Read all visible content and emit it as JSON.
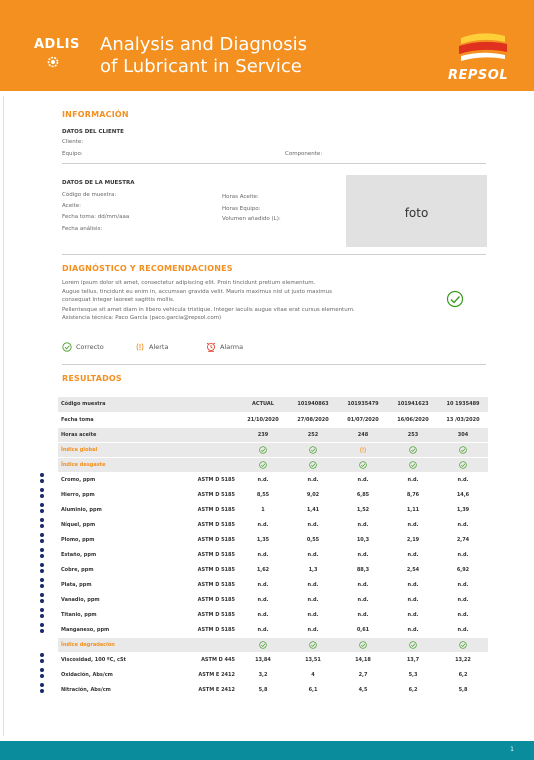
{
  "header": {
    "brand": "ADLIS",
    "title_line1": "Analysis and Diagnosis",
    "title_line2": "of Lubricant in Service",
    "logo_text": "REPSOL"
  },
  "info": {
    "heading": "INFORMACIÓN",
    "client_heading": "DATOS DEL CLIENTE",
    "cliente": "Cliente:",
    "equipo": "Equipo:",
    "componente": "Componente:"
  },
  "sample": {
    "heading": "DATOS DE LA MUESTRA",
    "codigo": "Código de muestra:",
    "aceite": "Aceite:",
    "fecha_toma": "Fecha toma: dd/mm/aaa",
    "fecha_analisis": "Fecha análisis:",
    "horas_aceite": "Horas Aceite:",
    "horas_equipo": "Horas Equipo:",
    "volumen": "Volumen añadido (L):",
    "foto": "foto"
  },
  "diagnosis": {
    "heading": "DIAGNÓSTICO Y RECOMENDACIONES",
    "line1": "Lorem ipsum dolor sit amet, consectetur adipiscing elit. Proin tincidunt pretium elementum.",
    "line2": "Augue tellus, tincidunt eu enim in, accumsan gravida velit. Mauris maximus nisl ut justo maximus",
    "line3": "consequat Integer laoreet sagittis mollis.",
    "line4": "Pellentesque sit amet diam in libero vehicula tristique. Integer iaculis augue vitae erat cursus elementum.",
    "line5": "Asistencia técnica: Paco García (paco.garcia@repsol.com)",
    "legend_ok": "Correcto",
    "legend_alert": "Alerta",
    "legend_alarm": "Alarma"
  },
  "results": {
    "heading": "RESULTADOS",
    "head_rows": [
      {
        "label": "Código muestra",
        "values": [
          "ACTUAL",
          "101940863",
          "101935479",
          "101941623",
          "10 1935489"
        ]
      },
      {
        "label": "Fecha toma",
        "values": [
          "21/10/2020",
          "27/08/2020",
          "01/07/2020",
          "16/06/2020",
          "13 /03/2020"
        ]
      },
      {
        "label": "Horas aceite",
        "values": [
          "239",
          "252",
          "248",
          "253",
          "304"
        ]
      }
    ],
    "index_global": {
      "label": "Índice global",
      "status": [
        "ok",
        "ok",
        "alert",
        "ok",
        "ok"
      ]
    },
    "index_wear": {
      "label": "Índice desgaste",
      "status": [
        "ok",
        "ok",
        "ok",
        "ok",
        "ok"
      ]
    },
    "wear_rows": [
      {
        "name": "Cromo, ppm",
        "std": "ASTM D 5185",
        "values": [
          "n.d.",
          "n.d.",
          "n.d.",
          "n.d.",
          "n.d."
        ],
        "colors": [
          "g",
          "g",
          "g",
          "g",
          "g"
        ]
      },
      {
        "name": "Hierro, ppm",
        "std": "ASTM D 5185",
        "values": [
          "8,55",
          "9,02",
          "6,85",
          "8,76",
          "14,6"
        ],
        "colors": [
          "g",
          "g",
          "g",
          "g",
          "g"
        ]
      },
      {
        "name": "Aluminio, ppm",
        "std": "ASTM D 5185",
        "values": [
          "1",
          "1,41",
          "1,52",
          "1,11",
          "1,39"
        ],
        "colors": [
          "g",
          "g",
          "g",
          "g",
          "g"
        ]
      },
      {
        "name": "Níquel, ppm",
        "std": "ASTM D 5185",
        "values": [
          "n.d.",
          "n.d.",
          "n.d.",
          "n.d.",
          "n.d."
        ],
        "colors": [
          "g",
          "g",
          "g",
          "g",
          "g"
        ]
      },
      {
        "name": "Plomo, ppm",
        "std": "ASTM D 5185",
        "values": [
          "1,35",
          "0,55",
          "10,3",
          "2,19",
          "2,74"
        ],
        "colors": [
          "g",
          "g",
          "o",
          "g",
          "g"
        ]
      },
      {
        "name": "Estaño, ppm",
        "std": "ASTM D 5185",
        "values": [
          "n.d.",
          "n.d.",
          "n.d.",
          "n.d.",
          "n.d."
        ],
        "colors": [
          "g",
          "g",
          "g",
          "g",
          "g"
        ]
      },
      {
        "name": "Cobre, ppm",
        "std": "ASTM D 5185",
        "values": [
          "1,62",
          "1,3",
          "88,3",
          "2,54",
          "6,92"
        ],
        "colors": [
          "g",
          "g",
          "o",
          "g",
          "g"
        ]
      },
      {
        "name": "Plata, ppm",
        "std": "ASTM D 5185",
        "values": [
          "n.d.",
          "n.d.",
          "n.d.",
          "n.d.",
          "n.d."
        ],
        "colors": [
          "g",
          "g",
          "g",
          "g",
          "g"
        ]
      },
      {
        "name": "Vanadio, ppm",
        "std": "ASTM D 5185",
        "values": [
          "n.d.",
          "n.d.",
          "n.d.",
          "n.d.",
          "n.d."
        ],
        "colors": [
          "g",
          "g",
          "g",
          "g",
          "g"
        ]
      },
      {
        "name": "Titanio, ppm",
        "std": "ASTM D 5185",
        "values": [
          "n.d.",
          "n.d.",
          "n.d.",
          "n.d.",
          "n.d."
        ],
        "colors": [
          "g",
          "g",
          "g",
          "g",
          "g"
        ]
      },
      {
        "name": "Manganeso, ppm",
        "std": "ASTM D 5185",
        "values": [
          "n.d.",
          "n.d.",
          "0,61",
          "n.d.",
          "n.d."
        ],
        "colors": [
          "g",
          "g",
          "g",
          "g",
          "g"
        ]
      }
    ],
    "index_degr": {
      "label": "Índice degradación",
      "status": [
        "ok",
        "ok",
        "ok",
        "ok",
        "ok"
      ]
    },
    "degr_rows": [
      {
        "name": "Viscosidad, 100 ºC, cSt",
        "std": "ASTM D 445",
        "values": [
          "13,84",
          "13,51",
          "14,18",
          "13,7",
          "13,22"
        ],
        "colors": [
          "g",
          "g",
          "g",
          "g",
          "g"
        ]
      },
      {
        "name": "Oxidación, Abs/cm",
        "std": "ASTM E 2412",
        "values": [
          "3,2",
          "4",
          "2,7",
          "5,3",
          "6,2"
        ],
        "colors": [
          "g",
          "g",
          "g",
          "g",
          "g"
        ]
      },
      {
        "name": "Nitración, Abs/cm",
        "std": "ASTM E 2412",
        "values": [
          "5,8",
          "6,1",
          "4,5",
          "6,2",
          "5,8"
        ],
        "colors": [
          "g",
          "g",
          "g",
          "g",
          "g"
        ]
      }
    ]
  },
  "footer": {
    "page": "1"
  },
  "colors": {
    "orange": "#f39020",
    "teal": "#0a8c9d",
    "green": "#3a9b1d",
    "navy": "#1a2a6c",
    "red": "#e0301e"
  }
}
